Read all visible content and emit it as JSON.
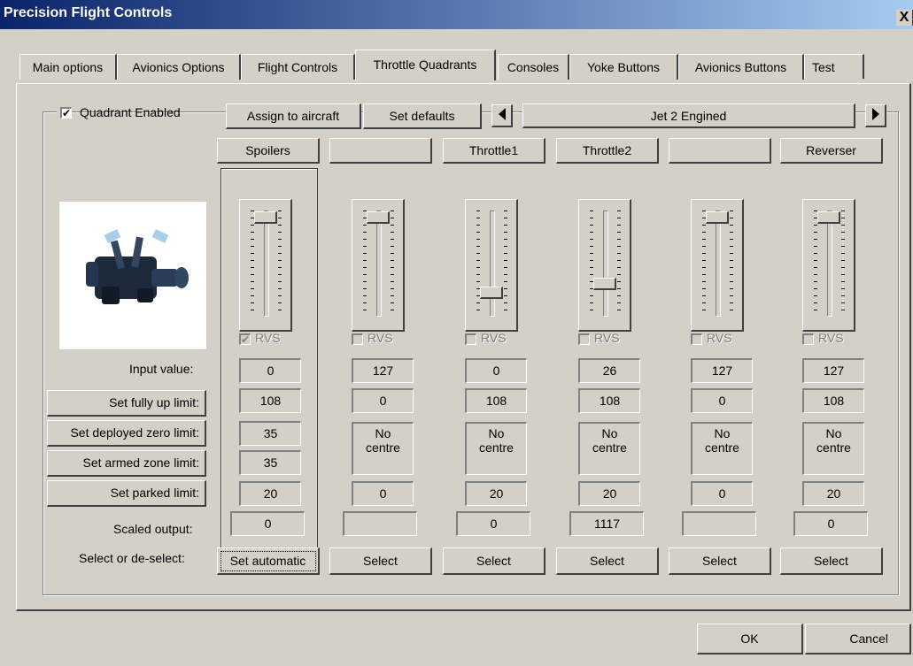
{
  "window": {
    "title": "Precision Flight Controls",
    "close_glyph": "X"
  },
  "tabs": [
    {
      "label": "Main options"
    },
    {
      "label": "Avionics Options"
    },
    {
      "label": "Flight Controls"
    },
    {
      "label": "Throttle Quadrants",
      "active": true
    },
    {
      "label": "Consoles"
    },
    {
      "label": "Yoke Buttons"
    },
    {
      "label": "Avionics Buttons"
    },
    {
      "label": "Test"
    }
  ],
  "quadrant": {
    "enabled_label": "Quadrant Enabled",
    "enabled": true,
    "assign_label": "Assign to aircraft",
    "defaults_label": "Set defaults",
    "aircraft": "Jet 2 Engined",
    "image_icon": "throttle-quadrant-icon"
  },
  "row_labels": {
    "input_value": "Input value:",
    "set_fully_up": "Set fully up limit:",
    "set_deployed_zero": "Set deployed zero limit:",
    "set_armed_zone": "Set armed zone limit:",
    "set_parked": "Set parked limit:",
    "scaled_output": "Scaled output:",
    "select_deselect": "Select or de-select:"
  },
  "columns": [
    {
      "name": "Spoilers",
      "slider_level": 0.05,
      "rvs": true,
      "rvs_label": "RVS",
      "input": "0",
      "fully_up": "108",
      "deployed_zero": "35",
      "armed_zone": "35",
      "parked": "20",
      "scaled": "0",
      "action": "Set automatic"
    },
    {
      "name": "",
      "slider_level": 0.05,
      "rvs": false,
      "rvs_label": "RVS",
      "input": "127",
      "fully_up": "0",
      "deployed_zero": "No\ncentre",
      "armed_zone": "",
      "parked": "0",
      "scaled": "",
      "action": "Select"
    },
    {
      "name": "Throttle1",
      "slider_level": 0.85,
      "rvs": false,
      "rvs_label": "RVS",
      "input": "0",
      "fully_up": "108",
      "deployed_zero": "No\ncentre",
      "armed_zone": "",
      "parked": "20",
      "scaled": "0",
      "action": "Select"
    },
    {
      "name": "Throttle2",
      "slider_level": 0.75,
      "rvs": false,
      "rvs_label": "RVS",
      "input": "26",
      "fully_up": "108",
      "deployed_zero": "No\ncentre",
      "armed_zone": "",
      "parked": "20",
      "scaled": "1117",
      "action": "Select"
    },
    {
      "name": "",
      "slider_level": 0.05,
      "rvs": false,
      "rvs_label": "RVS",
      "input": "127",
      "fully_up": "0",
      "deployed_zero": "No\ncentre",
      "armed_zone": "",
      "parked": "0",
      "scaled": "",
      "action": "Select"
    },
    {
      "name": "Reverser",
      "slider_level": 0.05,
      "rvs": false,
      "rvs_label": "RVS",
      "input": "127",
      "fully_up": "108",
      "deployed_zero": "No\ncentre",
      "armed_zone": "",
      "parked": "20",
      "scaled": "0",
      "action": "Select"
    }
  ],
  "footer": {
    "ok_label": "OK",
    "cancel_label": "Cancel"
  }
}
